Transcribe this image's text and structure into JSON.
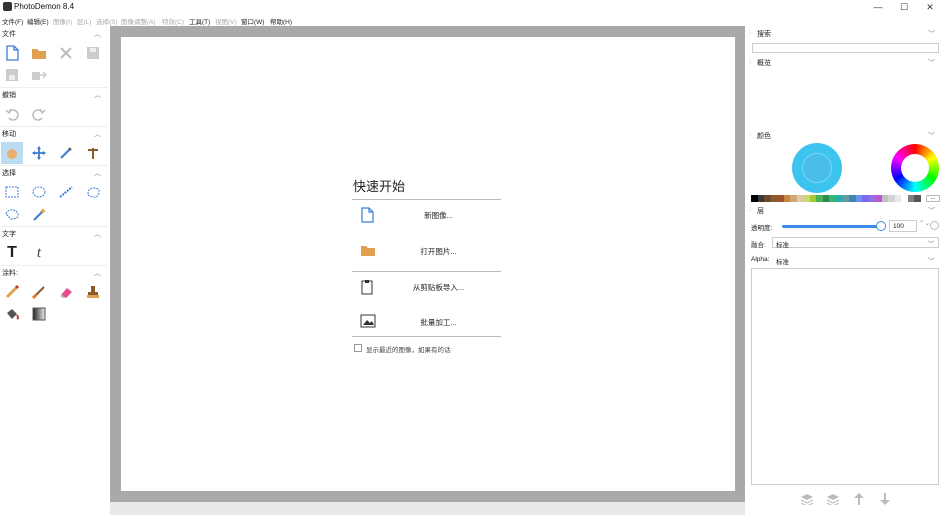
{
  "window": {
    "title": "PhotoDemon 8.4",
    "minimize": "—",
    "maximize": "☐",
    "close": "✕"
  },
  "menu": [
    {
      "label": "文件(F)",
      "enabled": true
    },
    {
      "label": "编辑(E)",
      "enabled": true
    },
    {
      "label": "图像(I)",
      "enabled": false
    },
    {
      "label": "层(L)",
      "enabled": false
    },
    {
      "label": "选择(S)",
      "enabled": false
    },
    {
      "label": "图像调整(A)",
      "enabled": false
    },
    {
      "label": "特效(C)",
      "enabled": false
    },
    {
      "label": "工具(T)",
      "enabled": true
    },
    {
      "label": "视图(V)",
      "enabled": false
    },
    {
      "label": "窗口(W)",
      "enabled": true
    },
    {
      "label": "帮助(H)",
      "enabled": true
    }
  ],
  "toolbox": {
    "sections": {
      "file": "文件",
      "undo": "撤销",
      "move": "移动",
      "select": "选择",
      "text": "文字",
      "paint": "涂料:"
    }
  },
  "quickstart": {
    "title": "快速开始",
    "new_image": "新图像...",
    "open_image": "打开图片...",
    "import_clipboard": "从剪贴板导入...",
    "batch": "批量加工...",
    "show_recent": "显示最近的图像，如果有的话"
  },
  "panels": {
    "search": "搜索",
    "overview": "概览",
    "color": "颜色",
    "layers": "层",
    "opacity_label": "透明度:",
    "opacity_value": "100",
    "blend_label": "融合:",
    "blend_value": "标准",
    "alpha_label": "Alpha:",
    "alpha_value": "标准",
    "palette_more": "..."
  },
  "colors": {
    "primary": "#3cc4ef",
    "accent": "#3a8ee6",
    "canvas_frame": "#a9a9a9",
    "palette": [
      "#000000",
      "#3a3a3a",
      "#6b4a2b",
      "#8b5a2b",
      "#a0522d",
      "#c68642",
      "#d2a679",
      "#e0c9a6",
      "#c8d96f",
      "#a4c639",
      "#4caf50",
      "#2e8b57",
      "#3cb371",
      "#20b2aa",
      "#5f9ea0",
      "#4682b4",
      "#6495ed",
      "#7b68ee",
      "#9370db",
      "#ba55d3",
      "#c0c0c0",
      "#d3d3d3",
      "#e8e8e8",
      "#ffffff",
      "#808080",
      "#555555"
    ]
  },
  "icons": [
    "new-file-icon",
    "open-folder-icon",
    "close-icon",
    "save-icon",
    "save-as-icon",
    "export-icon",
    "undo-icon",
    "redo-icon",
    "hand-icon",
    "move-icon",
    "color-picker-icon",
    "measure-icon",
    "rect-select-icon",
    "ellipse-select-icon",
    "line-select-icon",
    "lasso-select-icon",
    "polygon-select-icon",
    "magic-wand-icon",
    "text-icon",
    "typography-icon",
    "pencil-icon",
    "brush-icon",
    "eraser-icon",
    "clone-stamp-icon",
    "fill-icon",
    "gradient-icon"
  ]
}
